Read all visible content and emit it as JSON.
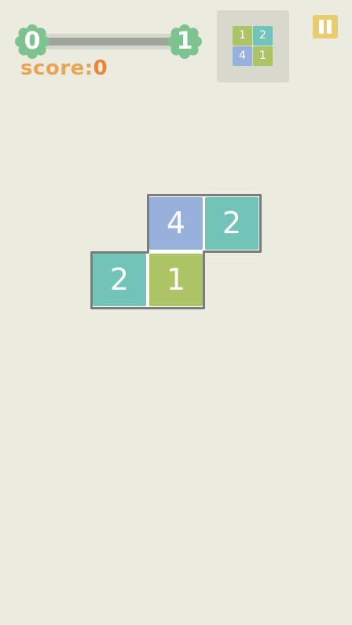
{
  "level": {
    "current": "0",
    "next": "1",
    "progress": 0
  },
  "score": {
    "label": "score:",
    "value": "0"
  },
  "next_piece": {
    "tiles": [
      {
        "value": "1",
        "color": "#acc466"
      },
      {
        "value": "2",
        "color": "#72c3b8"
      },
      {
        "value": "4",
        "color": "#98b0dc"
      },
      {
        "value": "1",
        "color": "#acc466"
      }
    ]
  },
  "piece": {
    "tiles": [
      {
        "value": "4",
        "color": "#98b0dc"
      },
      {
        "value": "2",
        "color": "#72c3b8"
      },
      {
        "value": "2",
        "color": "#72c3b8"
      },
      {
        "value": "1",
        "color": "#acc466"
      }
    ]
  },
  "colors": {
    "background": "#ecebdf",
    "badge": "#7dc28f",
    "score_label": "#e8a552",
    "pause": "#e9cc6f",
    "outline": "#7b7d7b"
  },
  "icons": {
    "pause": "pause-icon",
    "badge": "flower-badge-icon"
  }
}
